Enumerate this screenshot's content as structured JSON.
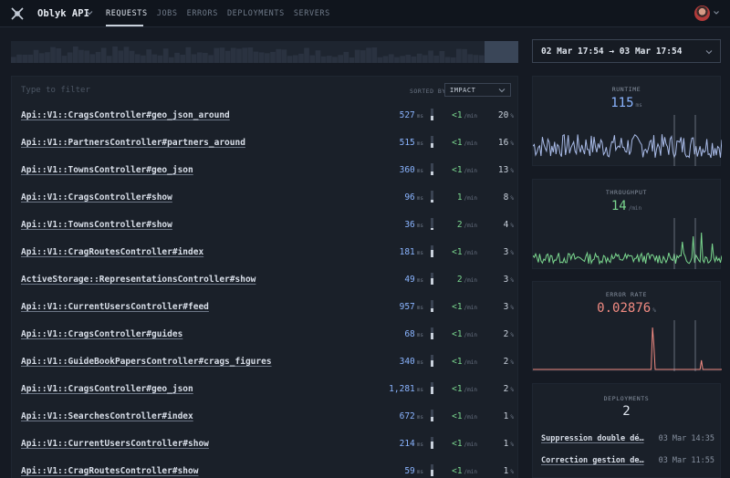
{
  "app": {
    "name": "Oblyk API"
  },
  "nav": [
    "REQUESTS",
    "JOBS",
    "ERRORS",
    "DEPLOYMENTS",
    "SERVERS"
  ],
  "filter": {
    "placeholder": "Type to filter"
  },
  "sort": {
    "label": "SORTED BY",
    "value": "IMPACT"
  },
  "requests": [
    {
      "name": "Api::V1::CragsController#geo_json_around",
      "ms": "527",
      "ms_unit": "ms",
      "tput": "<1",
      "tput_unit": "/min",
      "pct": "20",
      "pct_unit": "%",
      "bar": 0.4
    },
    {
      "name": "Api::V1::PartnersController#partners_around",
      "ms": "515",
      "ms_unit": "ms",
      "tput": "<1",
      "tput_unit": "/min",
      "pct": "16",
      "pct_unit": "%",
      "bar": 0.35
    },
    {
      "name": "Api::V1::TownsController#geo_json",
      "ms": "360",
      "ms_unit": "ms",
      "tput": "<1",
      "tput_unit": "/min",
      "pct": "13",
      "pct_unit": "%",
      "bar": 0.3
    },
    {
      "name": "Api::V1::CragsController#show",
      "ms": "96",
      "ms_unit": "ms",
      "tput": "1",
      "tput_unit": "/min",
      "pct": "8",
      "pct_unit": "%",
      "bar": 0.2
    },
    {
      "name": "Api::V1::TownsController#show",
      "ms": "36",
      "ms_unit": "ms",
      "tput": "2",
      "tput_unit": "/min",
      "pct": "4",
      "pct_unit": "%",
      "bar": 0.15
    },
    {
      "name": "Api::V1::CragRoutesController#index",
      "ms": "181",
      "ms_unit": "ms",
      "tput": "<1",
      "tput_unit": "/min",
      "pct": "3",
      "pct_unit": "%",
      "bar": 0.6
    },
    {
      "name": "ActiveStorage::RepresentationsController#show",
      "ms": "49",
      "ms_unit": "ms",
      "tput": "2",
      "tput_unit": "/min",
      "pct": "3",
      "pct_unit": "%",
      "bar": 0.55
    },
    {
      "name": "Api::V1::CurrentUsersController#feed",
      "ms": "957",
      "ms_unit": "ms",
      "tput": "<1",
      "tput_unit": "/min",
      "pct": "3",
      "pct_unit": "%",
      "bar": 0.3
    },
    {
      "name": "Api::V1::CragsController#guides",
      "ms": "68",
      "ms_unit": "ms",
      "tput": "<1",
      "tput_unit": "/min",
      "pct": "2",
      "pct_unit": "%",
      "bar": 0.5
    },
    {
      "name": "Api::V1::GuideBookPapersController#crags_figures",
      "ms": "340",
      "ms_unit": "ms",
      "tput": "<1",
      "tput_unit": "/min",
      "pct": "2",
      "pct_unit": "%",
      "bar": 0.55
    },
    {
      "name": "Api::V1::CragsController#geo_json",
      "ms": "1,281",
      "ms_unit": "ms",
      "tput": "<1",
      "tput_unit": "/min",
      "pct": "2",
      "pct_unit": "%",
      "bar": 0.6
    },
    {
      "name": "Api::V1::SearchesController#index",
      "ms": "672",
      "ms_unit": "ms",
      "tput": "<1",
      "tput_unit": "/min",
      "pct": "1",
      "pct_unit": "%",
      "bar": 0.35
    },
    {
      "name": "Api::V1::CurrentUsersController#show",
      "ms": "214",
      "ms_unit": "ms",
      "tput": "<1",
      "tput_unit": "/min",
      "pct": "1",
      "pct_unit": "%",
      "bar": 0.6
    },
    {
      "name": "Api::V1::CragRoutesController#show",
      "ms": "59",
      "ms_unit": "ms",
      "tput": "<1",
      "tput_unit": "/min",
      "pct": "1",
      "pct_unit": "%",
      "bar": 0.5
    }
  ],
  "date_range": "02 Mar 17:54 → 03 Mar 17:54",
  "runtime": {
    "title": "RUNTIME",
    "value": "115",
    "unit": "ms"
  },
  "throughput": {
    "title": "THROUGHPUT",
    "value": "14",
    "unit": "/min"
  },
  "error_rate": {
    "title": "ERROR RATE",
    "value": "0.02876",
    "unit": "%"
  },
  "deployments": {
    "title": "DEPLOYMENTS",
    "count": "2",
    "items": [
      {
        "title": "Suppression double dé…",
        "date": "03 Mar 14:35"
      },
      {
        "title": "Correction gestion de…",
        "date": "03 Mar 11:55"
      }
    ]
  },
  "colors": {
    "accent_blue": "#8ab4ff",
    "accent_green": "#7bd88f",
    "accent_red": "#f28b82"
  }
}
